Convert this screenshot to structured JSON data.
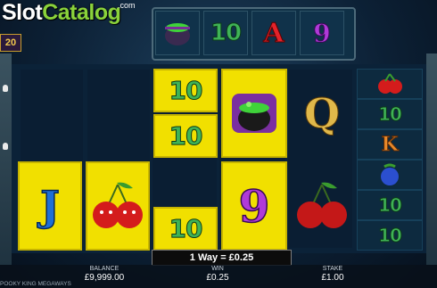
{
  "brand": {
    "logo_slot": "Slot",
    "logo_catalog": "Catalog",
    "logo_com": ".com"
  },
  "balance_badge": "20",
  "top_reel": [
    "cauldron",
    "10",
    "A",
    "9"
  ],
  "reels": [
    {
      "cells": [
        {
          "symbol": "J",
          "highlight": true
        }
      ]
    },
    {
      "cells": [
        {
          "symbol": "cherry",
          "highlight": true
        }
      ]
    },
    {
      "cells": [
        {
          "symbol": "10",
          "highlight": true
        },
        {
          "symbol": "10",
          "highlight": true
        },
        {
          "symbol": "10",
          "highlight": true
        }
      ]
    },
    {
      "cells": [
        {
          "symbol": "cauldron",
          "highlight": true
        },
        {
          "symbol": "9",
          "highlight": true
        }
      ]
    },
    {
      "cells": [
        {
          "symbol": "Q",
          "highlight": false
        },
        {
          "symbol": "cherry",
          "highlight": false
        }
      ]
    },
    {
      "cells": [
        {
          "symbol": "cherry",
          "highlight": false
        },
        {
          "symbol": "10",
          "highlight": false
        },
        {
          "symbol": "K",
          "highlight": false
        },
        {
          "symbol": "blueberry",
          "highlight": false
        },
        {
          "symbol": "10",
          "highlight": false
        },
        {
          "symbol": "10",
          "highlight": false
        }
      ]
    }
  ],
  "win_banner": "1 Way = £0.25",
  "footer": {
    "balance_label": "BALANCE",
    "balance_value": "£9,999.00",
    "win_label": "WIN",
    "win_value": "£0.25",
    "stake_label": "STAKE",
    "stake_value": "£1.00"
  },
  "game_name": "POOKY KING MEGAWAYS",
  "colors": {
    "highlight": "#f1e000",
    "ten": "#3fb356",
    "cherry": "#d41c1c",
    "brand_green": "#8ad23b"
  }
}
